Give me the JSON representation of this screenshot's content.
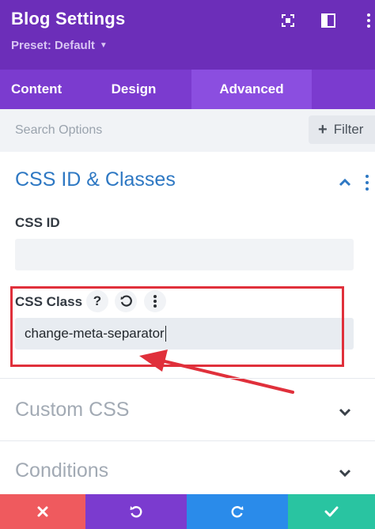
{
  "header": {
    "title": "Blog Settings",
    "preset_label": "Preset: Default",
    "icons": [
      "expand-icon",
      "sidebar-toggle-icon",
      "more-icon"
    ]
  },
  "tabs": [
    {
      "label": "Content",
      "active": false
    },
    {
      "label": "Design",
      "active": false
    },
    {
      "label": "Advanced",
      "active": true
    }
  ],
  "search": {
    "placeholder": "Search Options",
    "filter_label": "Filter"
  },
  "section": {
    "title": "CSS ID & Classes",
    "expanded": true
  },
  "fields": {
    "css_id": {
      "label": "CSS ID",
      "value": ""
    },
    "css_class": {
      "label": "CSS Class",
      "value": "change-meta-separator"
    }
  },
  "collapsed_sections": [
    {
      "title": "Custom CSS"
    },
    {
      "title": "Conditions"
    }
  ],
  "footer": {
    "buttons": [
      "cancel-icon",
      "undo-icon",
      "redo-icon",
      "save-icon"
    ]
  },
  "colors": {
    "header": "#6c2eb9",
    "tabs": "#7b3bcf",
    "active_tab": "#8b4ee0",
    "section_title": "#2e78c3",
    "annotation_red": "#e0303b",
    "cancel": "#ef5a5e",
    "undo": "#7b3bcf",
    "redo": "#2a8bea",
    "save": "#29c4a1"
  }
}
